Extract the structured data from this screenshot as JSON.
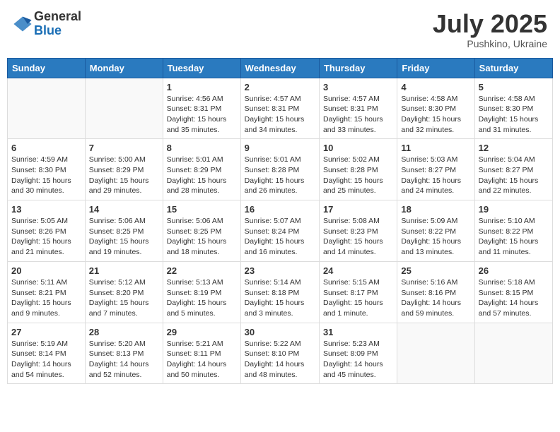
{
  "logo": {
    "general": "General",
    "blue": "Blue"
  },
  "header": {
    "month": "July 2025",
    "location": "Pushkino, Ukraine"
  },
  "weekdays": [
    "Sunday",
    "Monday",
    "Tuesday",
    "Wednesday",
    "Thursday",
    "Friday",
    "Saturday"
  ],
  "weeks": [
    [
      {
        "day": "",
        "sunrise": "",
        "sunset": "",
        "daylight": "",
        "empty": true
      },
      {
        "day": "",
        "sunrise": "",
        "sunset": "",
        "daylight": "",
        "empty": true
      },
      {
        "day": "1",
        "sunrise": "Sunrise: 4:56 AM",
        "sunset": "Sunset: 8:31 PM",
        "daylight": "Daylight: 15 hours and 35 minutes."
      },
      {
        "day": "2",
        "sunrise": "Sunrise: 4:57 AM",
        "sunset": "Sunset: 8:31 PM",
        "daylight": "Daylight: 15 hours and 34 minutes."
      },
      {
        "day": "3",
        "sunrise": "Sunrise: 4:57 AM",
        "sunset": "Sunset: 8:31 PM",
        "daylight": "Daylight: 15 hours and 33 minutes."
      },
      {
        "day": "4",
        "sunrise": "Sunrise: 4:58 AM",
        "sunset": "Sunset: 8:30 PM",
        "daylight": "Daylight: 15 hours and 32 minutes."
      },
      {
        "day": "5",
        "sunrise": "Sunrise: 4:58 AM",
        "sunset": "Sunset: 8:30 PM",
        "daylight": "Daylight: 15 hours and 31 minutes."
      }
    ],
    [
      {
        "day": "6",
        "sunrise": "Sunrise: 4:59 AM",
        "sunset": "Sunset: 8:30 PM",
        "daylight": "Daylight: 15 hours and 30 minutes."
      },
      {
        "day": "7",
        "sunrise": "Sunrise: 5:00 AM",
        "sunset": "Sunset: 8:29 PM",
        "daylight": "Daylight: 15 hours and 29 minutes."
      },
      {
        "day": "8",
        "sunrise": "Sunrise: 5:01 AM",
        "sunset": "Sunset: 8:29 PM",
        "daylight": "Daylight: 15 hours and 28 minutes."
      },
      {
        "day": "9",
        "sunrise": "Sunrise: 5:01 AM",
        "sunset": "Sunset: 8:28 PM",
        "daylight": "Daylight: 15 hours and 26 minutes."
      },
      {
        "day": "10",
        "sunrise": "Sunrise: 5:02 AM",
        "sunset": "Sunset: 8:28 PM",
        "daylight": "Daylight: 15 hours and 25 minutes."
      },
      {
        "day": "11",
        "sunrise": "Sunrise: 5:03 AM",
        "sunset": "Sunset: 8:27 PM",
        "daylight": "Daylight: 15 hours and 24 minutes."
      },
      {
        "day": "12",
        "sunrise": "Sunrise: 5:04 AM",
        "sunset": "Sunset: 8:27 PM",
        "daylight": "Daylight: 15 hours and 22 minutes."
      }
    ],
    [
      {
        "day": "13",
        "sunrise": "Sunrise: 5:05 AM",
        "sunset": "Sunset: 8:26 PM",
        "daylight": "Daylight: 15 hours and 21 minutes."
      },
      {
        "day": "14",
        "sunrise": "Sunrise: 5:06 AM",
        "sunset": "Sunset: 8:25 PM",
        "daylight": "Daylight: 15 hours and 19 minutes."
      },
      {
        "day": "15",
        "sunrise": "Sunrise: 5:06 AM",
        "sunset": "Sunset: 8:25 PM",
        "daylight": "Daylight: 15 hours and 18 minutes."
      },
      {
        "day": "16",
        "sunrise": "Sunrise: 5:07 AM",
        "sunset": "Sunset: 8:24 PM",
        "daylight": "Daylight: 15 hours and 16 minutes."
      },
      {
        "day": "17",
        "sunrise": "Sunrise: 5:08 AM",
        "sunset": "Sunset: 8:23 PM",
        "daylight": "Daylight: 15 hours and 14 minutes."
      },
      {
        "day": "18",
        "sunrise": "Sunrise: 5:09 AM",
        "sunset": "Sunset: 8:22 PM",
        "daylight": "Daylight: 15 hours and 13 minutes."
      },
      {
        "day": "19",
        "sunrise": "Sunrise: 5:10 AM",
        "sunset": "Sunset: 8:22 PM",
        "daylight": "Daylight: 15 hours and 11 minutes."
      }
    ],
    [
      {
        "day": "20",
        "sunrise": "Sunrise: 5:11 AM",
        "sunset": "Sunset: 8:21 PM",
        "daylight": "Daylight: 15 hours and 9 minutes."
      },
      {
        "day": "21",
        "sunrise": "Sunrise: 5:12 AM",
        "sunset": "Sunset: 8:20 PM",
        "daylight": "Daylight: 15 hours and 7 minutes."
      },
      {
        "day": "22",
        "sunrise": "Sunrise: 5:13 AM",
        "sunset": "Sunset: 8:19 PM",
        "daylight": "Daylight: 15 hours and 5 minutes."
      },
      {
        "day": "23",
        "sunrise": "Sunrise: 5:14 AM",
        "sunset": "Sunset: 8:18 PM",
        "daylight": "Daylight: 15 hours and 3 minutes."
      },
      {
        "day": "24",
        "sunrise": "Sunrise: 5:15 AM",
        "sunset": "Sunset: 8:17 PM",
        "daylight": "Daylight: 15 hours and 1 minute."
      },
      {
        "day": "25",
        "sunrise": "Sunrise: 5:16 AM",
        "sunset": "Sunset: 8:16 PM",
        "daylight": "Daylight: 14 hours and 59 minutes."
      },
      {
        "day": "26",
        "sunrise": "Sunrise: 5:18 AM",
        "sunset": "Sunset: 8:15 PM",
        "daylight": "Daylight: 14 hours and 57 minutes."
      }
    ],
    [
      {
        "day": "27",
        "sunrise": "Sunrise: 5:19 AM",
        "sunset": "Sunset: 8:14 PM",
        "daylight": "Daylight: 14 hours and 54 minutes."
      },
      {
        "day": "28",
        "sunrise": "Sunrise: 5:20 AM",
        "sunset": "Sunset: 8:13 PM",
        "daylight": "Daylight: 14 hours and 52 minutes."
      },
      {
        "day": "29",
        "sunrise": "Sunrise: 5:21 AM",
        "sunset": "Sunset: 8:11 PM",
        "daylight": "Daylight: 14 hours and 50 minutes."
      },
      {
        "day": "30",
        "sunrise": "Sunrise: 5:22 AM",
        "sunset": "Sunset: 8:10 PM",
        "daylight": "Daylight: 14 hours and 48 minutes."
      },
      {
        "day": "31",
        "sunrise": "Sunrise: 5:23 AM",
        "sunset": "Sunset: 8:09 PM",
        "daylight": "Daylight: 14 hours and 45 minutes."
      },
      {
        "day": "",
        "sunrise": "",
        "sunset": "",
        "daylight": "",
        "empty": true
      },
      {
        "day": "",
        "sunrise": "",
        "sunset": "",
        "daylight": "",
        "empty": true
      }
    ]
  ]
}
